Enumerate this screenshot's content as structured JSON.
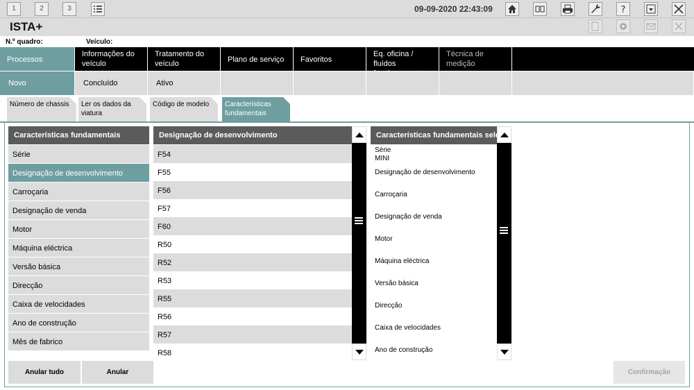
{
  "toolbar": {
    "btn1": "1",
    "btn2": "2",
    "btn3": "3",
    "datetime": "09-09-2020 22:43:09",
    "icons": [
      "list-icon",
      "home-icon",
      "split-screen-icon",
      "print-icon",
      "wrench-icon",
      "help-icon",
      "download-icon",
      "close-icon"
    ]
  },
  "title": {
    "app": "ISTA+"
  },
  "vehicle": {
    "vin_label": "N.º quadro:",
    "vehicle_label": "Veículo:"
  },
  "main_nav": [
    {
      "label": "Processos"
    },
    {
      "label": "Informações do veículo"
    },
    {
      "label": "Tratamento do veículo"
    },
    {
      "label": "Plano de serviço"
    },
    {
      "label": "Favoritos"
    },
    {
      "label": "Eq. oficina / fluídos funcionamento"
    },
    {
      "label": "Técnica de medição"
    }
  ],
  "sub_nav": [
    {
      "label": "Novo"
    },
    {
      "label": "Concluído"
    },
    {
      "label": "Ativo"
    }
  ],
  "steps": [
    {
      "label": "Número de chassis"
    },
    {
      "label": "Ler os dados da viatura"
    },
    {
      "label": "Código de modelo"
    },
    {
      "label": "Características fundamentais"
    }
  ],
  "categories": {
    "header": "Características fundamentais",
    "items": [
      "Série",
      "Designação de desenvolvimento",
      "Carroçaria",
      "Designação de venda",
      "Motor",
      "Máquina eléctrica",
      "Versão básica",
      "Direcção",
      "Caixa de velocidades",
      "Ano de construção",
      "Mês de fabrico"
    ],
    "selected_index": 1
  },
  "dev_list": {
    "header": "Designação de desenvolvimento",
    "items": [
      "F54",
      "F55",
      "F56",
      "F57",
      "F60",
      "R50",
      "R52",
      "R53",
      "R55",
      "R56",
      "R57",
      "R58"
    ]
  },
  "selected_features": {
    "header": "Características fundamentais seleccionadas",
    "groups": [
      {
        "name": "Série",
        "value": "MINI"
      },
      {
        "name": "Designação de desenvolvimento",
        "value": ""
      },
      {
        "name": "Carroçaria",
        "value": ""
      },
      {
        "name": "Designação de venda",
        "value": ""
      },
      {
        "name": "Motor",
        "value": ""
      },
      {
        "name": "Máquina eléctrica",
        "value": ""
      },
      {
        "name": "Versão básica",
        "value": ""
      },
      {
        "name": "Direcção",
        "value": ""
      },
      {
        "name": "Caixa de velocidades",
        "value": ""
      },
      {
        "name": "Ano de construção",
        "value": ""
      }
    ]
  },
  "buttons": {
    "cancel_all": "Anular tudo",
    "cancel": "Anular",
    "confirm": "Confirmação"
  },
  "colors": {
    "accent": "#6e9ea0",
    "header_dark": "#5b5b5b",
    "row_grey": "#dcdcdc"
  }
}
